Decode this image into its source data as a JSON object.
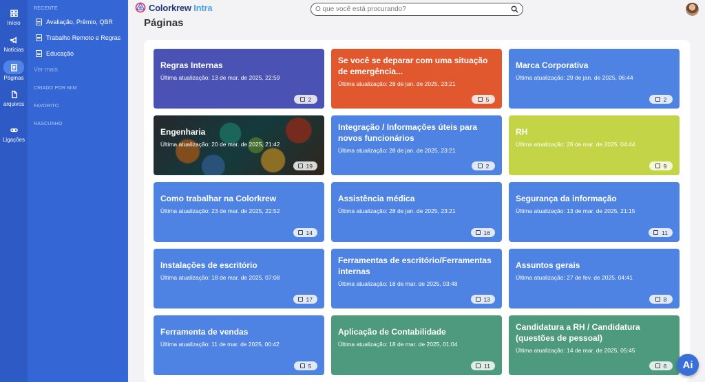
{
  "rail": [
    {
      "label": "Início",
      "icon": "grid-icon"
    },
    {
      "label": "Notícias",
      "icon": "megaphone-icon"
    },
    {
      "label": "Páginas",
      "icon": "page-icon",
      "active": true
    },
    {
      "label": "arquivos",
      "icon": "file-icon"
    },
    {
      "label": "Ligações",
      "icon": "link-icon"
    }
  ],
  "sidebar": {
    "recent_header": "RECENTE",
    "recent": [
      "Avaliação, Prêmio, QBR",
      "Trabalho Remoto e Regras",
      "Educação"
    ],
    "more_dots": "···",
    "see_more": "Ver mais",
    "created_by_me": "CRIADO POR MIM",
    "favorites": "FAVORITO",
    "draft": "RASCUNHO"
  },
  "header": {
    "logo_main": "Colorkrew",
    "logo_accent": "Intra",
    "search_placeholder": "O que você está procurando?"
  },
  "page_title": "Páginas",
  "cards": [
    {
      "title": "Regras Internas",
      "updated": "Última atualização: 13 de mar. de 2025, 22:59",
      "count": "2",
      "color": "#4a52b4"
    },
    {
      "title": "Se você se deparar com uma situação de emergência...",
      "updated": "Última atualização: 28 de jan. de 2025, 23:21",
      "count": "5",
      "color": "#e2582e"
    },
    {
      "title": "Marca Corporativa",
      "updated": "Última atualização: 29 de jan. de 2025, 06:44",
      "count": "2",
      "color": "#4e83e3"
    },
    {
      "title": "Engenharia",
      "updated": "Última atualização: 20 de mar. de 2025, 21:42",
      "count": "19",
      "color": "image"
    },
    {
      "title": "Integração / Informações úteis para novos funcionários",
      "updated": "Última atualização: 28 de jan. de 2025, 23:21",
      "count": "2",
      "color": "#4e83e3"
    },
    {
      "title": "RH",
      "updated": "Última atualização: 26 de mar. de 2025, 04:44",
      "count": "9",
      "color": "#c3d546"
    },
    {
      "title": "Como trabalhar na Colorkrew",
      "updated": "Última atualização: 23 de mar. de 2025, 22:52",
      "count": "14",
      "color": "#4e83e3"
    },
    {
      "title": "Assistência médica",
      "updated": "Última atualização: 28 de jan. de 2025, 23:21",
      "count": "16",
      "color": "#4e83e3"
    },
    {
      "title": "Segurança da informação",
      "updated": "Última atualização: 13 de mar. de 2025, 21:15",
      "count": "11",
      "color": "#4e83e3"
    },
    {
      "title": "Instalações de escritório",
      "updated": "Última atualização: 18 de mar. de 2025, 07:08",
      "count": "17",
      "color": "#4e83e3"
    },
    {
      "title": "Ferramentas de escritório/Ferramentas internas",
      "updated": "Última atualização: 18 de mar. de 2025, 03:48",
      "count": "13",
      "color": "#4e83e3"
    },
    {
      "title": "Assuntos gerais",
      "updated": "Última atualização: 27 de fev. de 2025, 04:41",
      "count": "8",
      "color": "#4e83e3"
    },
    {
      "title": "Ferramenta de vendas",
      "updated": "Última atualização: 11 de mar. de 2025, 00:42",
      "count": "5",
      "color": "#4e83e3"
    },
    {
      "title": "Aplicação de Contabilidade",
      "updated": "Última atualização: 18 de mar. de 2025, 01:04",
      "count": "11",
      "color": "#4e9a7e"
    },
    {
      "title": "Candidatura a RH / Candidatura (questões de pessoal)",
      "updated": "Última atualização: 14 de mar. de 2025, 05:45",
      "count": "6",
      "color": "#4e9a7e"
    }
  ],
  "ai_button": "Ai"
}
